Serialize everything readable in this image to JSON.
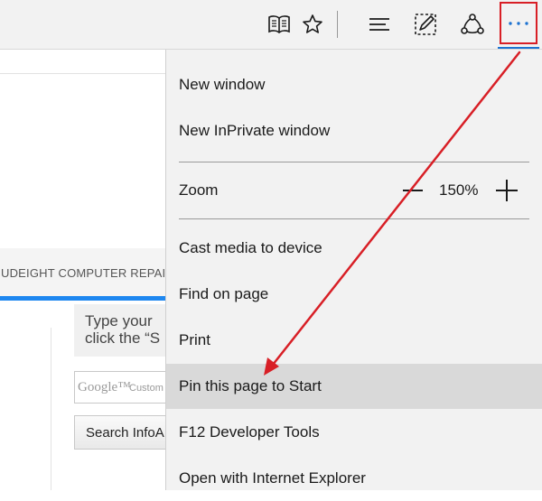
{
  "toolbar": {
    "buttons": [
      {
        "name": "reading-view-button",
        "icon": "open-book-icon"
      },
      {
        "name": "favorites-button",
        "icon": "star-icon"
      },
      {
        "name": "hub-button",
        "icon": "hub-lines-icon"
      },
      {
        "name": "web-note-button",
        "icon": "pen-note-icon"
      },
      {
        "name": "share-button",
        "icon": "share-icon"
      },
      {
        "name": "more-actions-button",
        "icon": "ellipsis-icon",
        "label": "···",
        "active": true
      }
    ],
    "accent_color": "#1e73d1",
    "highlight_color": "#d81f26"
  },
  "page": {
    "nav_text": "UDEIGHT COMPUTER REPAIR",
    "nav_accent_color": "#1e87f0",
    "search_prompt_line1": "Type your",
    "search_prompt_line2": "click the “S",
    "google_logo": "Google™",
    "google_custom": "Custom",
    "search_button": "Search InfoA"
  },
  "menu": {
    "items_top": [
      {
        "label": "New window"
      },
      {
        "label": "New InPrivate window"
      }
    ],
    "zoom": {
      "label": "Zoom",
      "value": "150%"
    },
    "items_bottom": [
      {
        "label": "Cast media to device"
      },
      {
        "label": "Find on page"
      },
      {
        "label": "Print"
      },
      {
        "label": "Pin this page to Start",
        "highlighted": true
      },
      {
        "label": "F12 Developer Tools"
      },
      {
        "label": "Open with Internet Explorer"
      }
    ]
  },
  "annotation": {
    "color": "#d81f26"
  }
}
